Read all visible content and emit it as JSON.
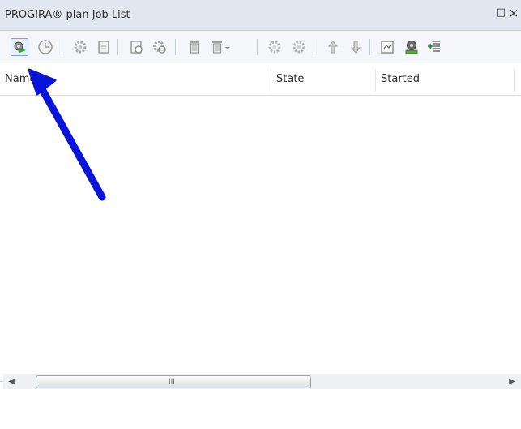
{
  "window": {
    "title": "PROGIRA® plan Job List",
    "maximize_icon": "□",
    "close_icon": "×"
  },
  "toolbar": {
    "buttons": [
      {
        "name": "run-job-icon",
        "active": true
      },
      {
        "name": "schedule-clock-icon"
      },
      {
        "name": "job-gear-icon"
      },
      {
        "name": "job-document-icon"
      },
      {
        "name": "refresh-document-icon"
      },
      {
        "name": "gear-refresh-icon"
      },
      {
        "name": "trash-icon"
      },
      {
        "name": "trash-dropdown-icon"
      },
      {
        "name": "settings-gear-icon"
      },
      {
        "name": "settings-gear-alt-icon"
      },
      {
        "name": "move-up-icon"
      },
      {
        "name": "move-down-icon"
      },
      {
        "name": "report-document-icon"
      },
      {
        "name": "job-server-icon"
      },
      {
        "name": "export-list-icon"
      }
    ]
  },
  "list": {
    "columns": [
      "Name",
      "State",
      "Started"
    ],
    "rows": []
  },
  "scrollbar": {
    "left_arrow": "◀",
    "right_arrow": "▶",
    "grip": "III"
  },
  "annotation": {
    "arrow_color": "#0a14d6"
  }
}
